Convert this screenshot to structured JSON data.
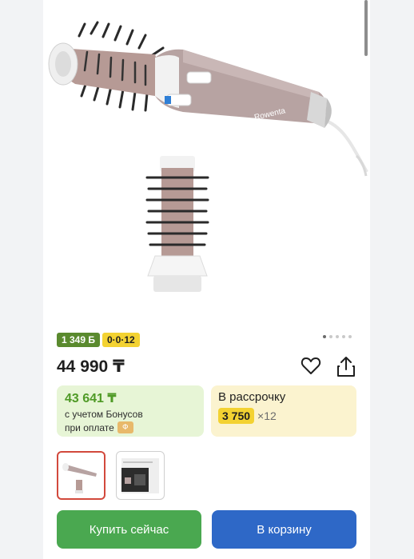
{
  "product": {
    "image_icon": "rotating-brush-hair-dryer",
    "brand_label": "Rowenta",
    "price": "44 990 ₸",
    "bonus_badge": "1 349 Б",
    "installment_badge": "0·0·12",
    "gallery_count": 5,
    "gallery_active_index": 0
  },
  "bonus_card": {
    "amount": "43 641 ₸",
    "line1": "с учетом Бонусов",
    "line2": "при оплате"
  },
  "installment_card": {
    "title": "В рассрочку",
    "monthly": "3 750",
    "months": "×12"
  },
  "thumbnails": [
    {
      "name": "thumbnail-product"
    },
    {
      "name": "thumbnail-box"
    }
  ],
  "actions": {
    "buy_now": "Купить сейчас",
    "add_to_cart": "В корзину"
  },
  "colors": {
    "buy_button": "#4aa850",
    "cart_button": "#2e68c7",
    "bonus_green": "#5a8a2e",
    "installment_yellow": "#f3d232"
  }
}
